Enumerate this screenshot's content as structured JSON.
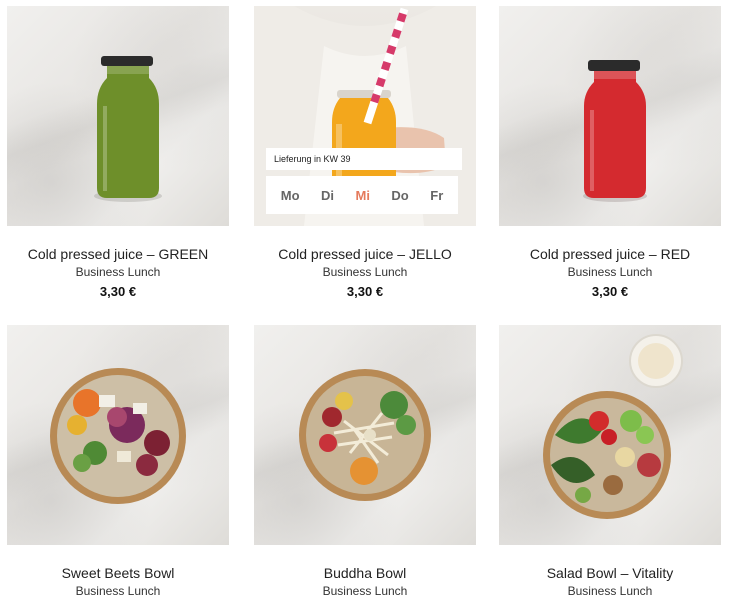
{
  "products": [
    {
      "title": "Cold pressed juice – GREEN",
      "category": "Business Lunch",
      "price": "3,30 €"
    },
    {
      "title": "Cold pressed juice – JELLO",
      "category": "Business Lunch",
      "price": "3,30 €"
    },
    {
      "title": "Cold pressed juice – RED",
      "category": "Business Lunch",
      "price": "3,30 €"
    },
    {
      "title": "Sweet Beets Bowl",
      "category": "Business Lunch"
    },
    {
      "title": "Buddha Bowl",
      "category": "Business Lunch"
    },
    {
      "title": "Salad Bowl – Vitality",
      "category": "Business Lunch"
    }
  ],
  "delivery": {
    "label": "Lieferung in KW 39",
    "days": [
      "Mo",
      "Di",
      "Mi",
      "Do",
      "Fr"
    ],
    "selected_day": "Mi"
  },
  "colors": {
    "accent": "#e57a5c",
    "juice_green": "#6e8f2a",
    "juice_yellow": "#f3a71c",
    "juice_red": "#d42a2f"
  }
}
